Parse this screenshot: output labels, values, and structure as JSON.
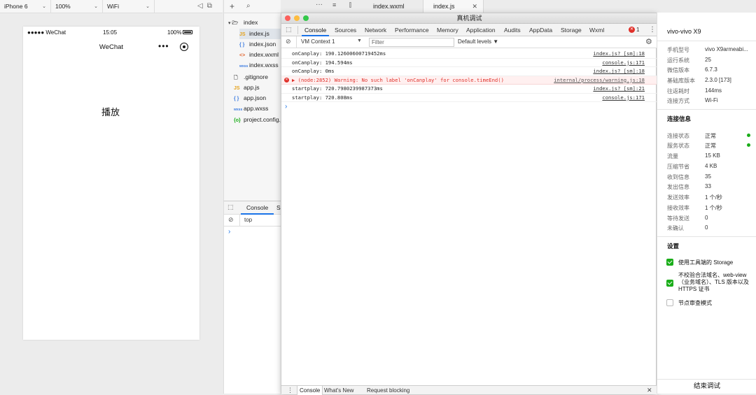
{
  "simulator": {
    "device": "iPhone 6",
    "zoom": "100%",
    "network": "WiFi"
  },
  "phone": {
    "status_left": "●●●●● WeChat",
    "time": "15:05",
    "battery": "100%",
    "nav_title": "WeChat",
    "nav_more": "•••",
    "content_text": "播放"
  },
  "filetree": {
    "items": [
      {
        "label": "index",
        "icon": "▾ 🗁"
      },
      {
        "label": "index.js",
        "icon": "JS"
      },
      {
        "label": "index.json",
        "icon": "{ }"
      },
      {
        "label": "index.wxml",
        "icon": "<>"
      },
      {
        "label": "index.wxss",
        "icon": "wxss"
      },
      {
        "label": ".gitignore",
        "icon": "🗋"
      },
      {
        "label": "app.js",
        "icon": "JS"
      },
      {
        "label": "app.json",
        "icon": "{ }"
      },
      {
        "label": "app.wxss",
        "icon": "wxss"
      },
      {
        "label": "project.config.json",
        "icon": "{o}"
      }
    ]
  },
  "miniconsole": {
    "tab": "Console",
    "tab2": "S",
    "context": "top",
    "prompt": "›"
  },
  "editor": {
    "tabs": [
      "index.wxml",
      "index.js"
    ]
  },
  "devtools": {
    "title": "真机调试",
    "tabs": [
      "Console",
      "Sources",
      "Network",
      "Performance",
      "Memory",
      "Application",
      "Audits",
      "AppData",
      "Storage",
      "Wxml"
    ],
    "error_count": "1",
    "context": "VM Context 1",
    "filter_placeholder": "Filter",
    "levels": "Default levels ▼",
    "logs": [
      {
        "msg": "onCanplay: 190.12600600719452ms",
        "src": "index.js? [sm]:18",
        "level": "log"
      },
      {
        "msg": "onCanplay: 194.594ms",
        "src": "console.js:171",
        "level": "log"
      },
      {
        "msg": "onCanplay: 0ms",
        "src": "index.js? [sm]:18",
        "level": "log"
      },
      {
        "msg": "▶ (node:2852) Warning: No such label 'onCanplay' for console.timeEnd()",
        "src": "internal/process/warning.js:18",
        "level": "warn"
      },
      {
        "msg": "startplay: 720.7980239987373ms",
        "src": "index.js? [sm]:21",
        "level": "log"
      },
      {
        "msg": "startplay: 720.808ms",
        "src": "console.js:171",
        "level": "log"
      }
    ],
    "prompt": "›",
    "drawer_tabs": [
      "Console",
      "What's New",
      "Request blocking"
    ]
  },
  "rightpanel": {
    "device_name": "vivo-vivo X9",
    "device_info": [
      {
        "label": "手机型号",
        "value": "vivo X9armeabi..."
      },
      {
        "label": "运行系统",
        "value": "25"
      },
      {
        "label": "微信版本",
        "value": "6.7.3"
      },
      {
        "label": "基础库版本",
        "value": "2.3.0 [173]"
      },
      {
        "label": "往返耗时",
        "value": "144ms"
      },
      {
        "label": "连接方式",
        "value": "Wi-Fi"
      }
    ],
    "conn_title": "连接信息",
    "conn_info": [
      {
        "label": "连接状态",
        "value": "正常"
      },
      {
        "label": "服务状态",
        "value": "正常"
      },
      {
        "label": "流量",
        "value": "15 KB"
      },
      {
        "label": "压缩节省",
        "value": "4 KB"
      },
      {
        "label": "收到信息",
        "value": "35"
      },
      {
        "label": "发出信息",
        "value": "33"
      },
      {
        "label": "发送效率",
        "value": "1 个/秒"
      },
      {
        "label": "接收效率",
        "value": "1 个/秒"
      },
      {
        "label": "等待发送",
        "value": "0"
      },
      {
        "label": "未确认",
        "value": "0"
      }
    ],
    "settings_title": "设置",
    "settings": [
      {
        "label": "使用工具端的 Storage",
        "checked": true
      },
      {
        "label": "不校验合法域名、web-view（业务域名）、TLS 版本以及 HTTPS 证书",
        "checked": true
      },
      {
        "label": "节点审查模式",
        "checked": false
      }
    ],
    "end_button": "结束调试"
  },
  "colors": {
    "accent": "#1a73e8",
    "success": "#1aad19",
    "error": "#e0302a"
  }
}
